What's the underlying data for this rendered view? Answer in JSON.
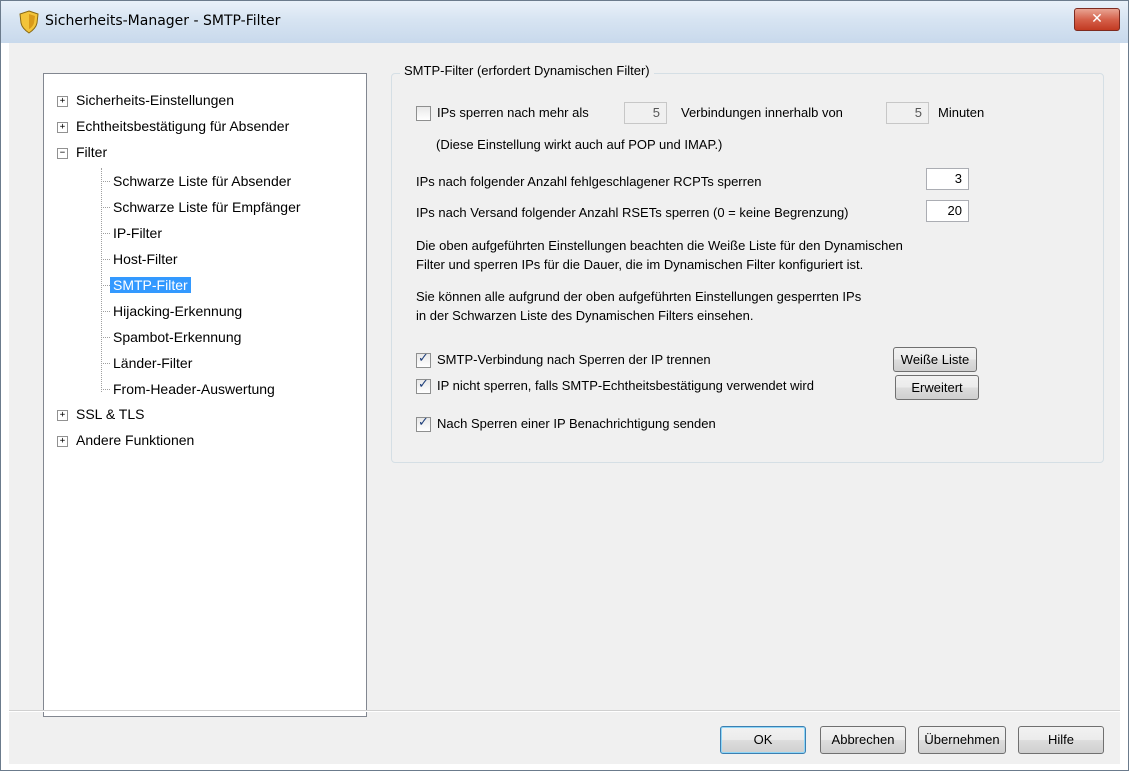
{
  "window": {
    "title": "Sicherheits-Manager - SMTP-Filter",
    "close": "✕"
  },
  "tree": {
    "items": [
      {
        "label": "Sicherheits-Einstellungen",
        "expander": "+"
      },
      {
        "label": "Echtheitsbestätigung für Absender",
        "expander": "+"
      },
      {
        "label": "Filter",
        "expander": "−"
      },
      {
        "label": "Schwarze Liste für Absender"
      },
      {
        "label": "Schwarze Liste für Empfänger"
      },
      {
        "label": "IP-Filter"
      },
      {
        "label": "Host-Filter"
      },
      {
        "label": "SMTP-Filter",
        "selected": true
      },
      {
        "label": "Hijacking-Erkennung"
      },
      {
        "label": "Spambot-Erkennung"
      },
      {
        "label": "Länder-Filter"
      },
      {
        "label": "From-Header-Auswertung"
      },
      {
        "label": "SSL & TLS",
        "expander": "+"
      },
      {
        "label": "Andere Funktionen",
        "expander": "+"
      }
    ]
  },
  "group": {
    "title": "SMTP-Filter (erfordert Dynamischen Filter)",
    "block_ips": {
      "label": "IPs sperren nach mehr als",
      "checked": false,
      "count": "5",
      "mid_label": "Verbindungen innerhalb von",
      "minutes": "5",
      "unit": "Minuten"
    },
    "note": "(Diese Einstellung wirkt auch auf POP und IMAP.)",
    "rcpt": {
      "label": "IPs nach folgender Anzahl fehlgeschlagener RCPTs sperren",
      "value": "3"
    },
    "rset": {
      "label": "IPs nach Versand folgender Anzahl RSETs sperren (0 = keine Begrenzung)",
      "value": "20"
    },
    "info1": [
      "Die oben aufgeführten Einstellungen beachten die Weiße Liste für den Dynamischen",
      "Filter und sperren IPs für die Dauer, die im Dynamischen Filter konfiguriert ist."
    ],
    "info2": [
      "Sie können alle aufgrund der oben aufgeführten Einstellungen gesperrten IPs",
      "in der Schwarzen Liste des Dynamischen Filters einsehen."
    ],
    "opt_disconnect": {
      "label": "SMTP-Verbindung nach Sperren der IP trennen",
      "checked": true
    },
    "opt_auth": {
      "label": "IP nicht sperren, falls SMTP-Echtheitsbestätigung verwendet wird",
      "checked": true
    },
    "opt_notify": {
      "label": "Nach Sperren einer IP Benachrichtigung senden",
      "checked": true
    },
    "whitelist_button": "Weiße Liste",
    "advanced_button": "Erweitert"
  },
  "footer": {
    "ok": "OK",
    "cancel": "Abbrechen",
    "apply": "Übernehmen",
    "help": "Hilfe"
  }
}
